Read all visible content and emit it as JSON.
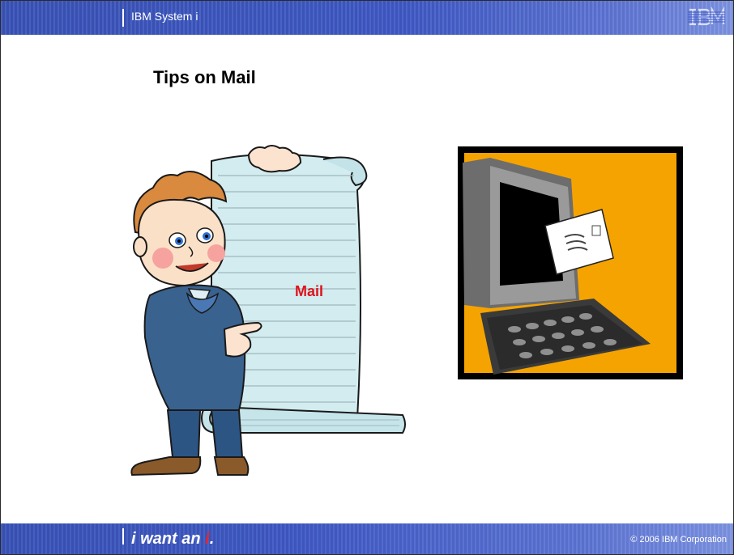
{
  "header": {
    "title": "IBM System i",
    "logo_text": "IBM"
  },
  "slide": {
    "heading": "Tips on Mail",
    "scroll_label": "Mail"
  },
  "footer": {
    "tagline_prefix": "i want an ",
    "tagline_accent": "i",
    "tagline_suffix": ".",
    "copyright": "© 2006 IBM Corporation"
  },
  "colors": {
    "bar_blue": "#3f59c6",
    "accent_red": "#e5262b",
    "mail_red": "#e0121b",
    "monitor_bg": "#f5a300"
  },
  "images": {
    "boy_clipart": "boy-holding-scroll",
    "computer_clipart": "computer-sending-letter"
  }
}
